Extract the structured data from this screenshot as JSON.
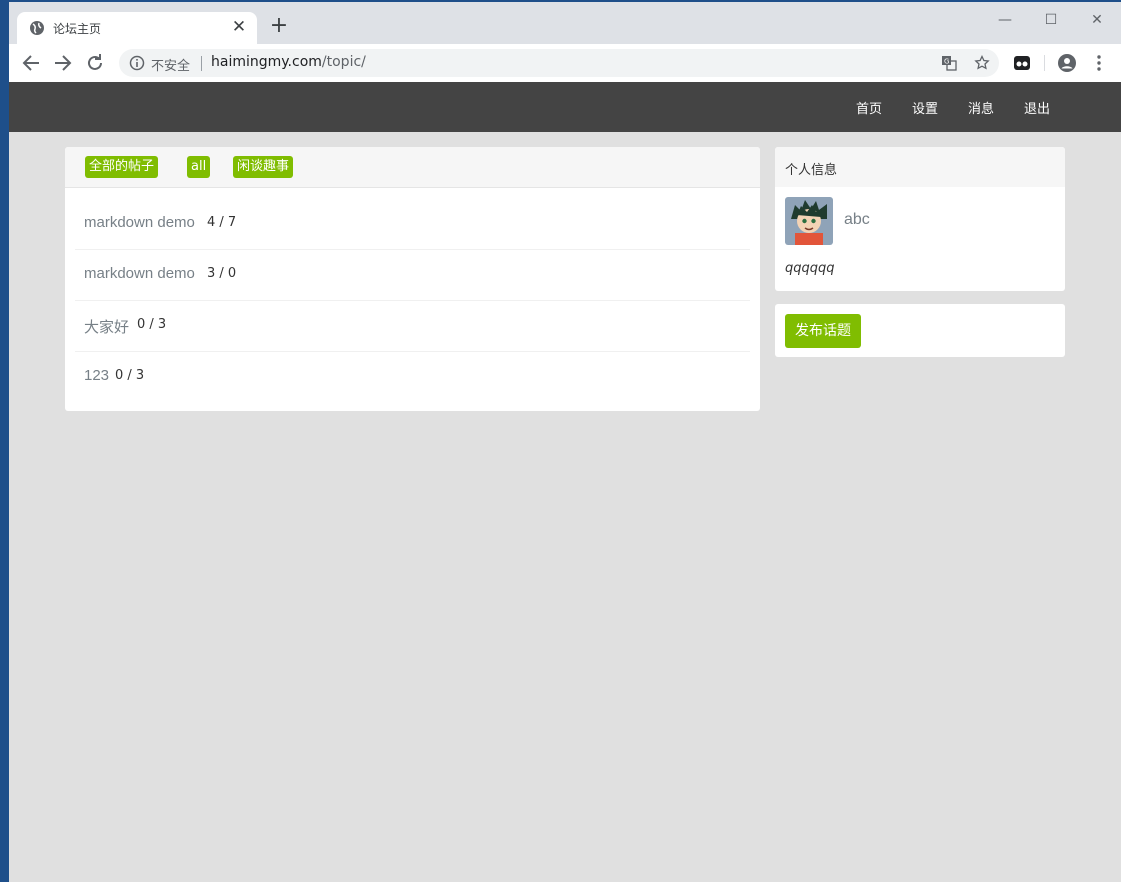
{
  "browser": {
    "tab_title": "论坛主页",
    "security_label": "不安全",
    "url_host": "haimingmy.com",
    "url_path": "/topic/"
  },
  "site_nav": {
    "items": [
      "首页",
      "设置",
      "消息",
      "退出"
    ]
  },
  "topic_tabs": [
    "全部的帖子",
    "all",
    "闲谈趣事"
  ],
  "topics": [
    {
      "title": "markdown demo",
      "count": "4 / 7"
    },
    {
      "title": "markdown demo",
      "count": "3 / 0"
    },
    {
      "title": "大家好",
      "count": "0 / 3"
    },
    {
      "title": "123",
      "count": "0 / 3"
    }
  ],
  "profile": {
    "header": "个人信息",
    "username": "abc",
    "signature": "qqqqqq"
  },
  "publish_button": "发布话题",
  "colors": {
    "accent": "#80bd01",
    "header_bg": "#444444",
    "page_bg": "#e0e0e0"
  }
}
